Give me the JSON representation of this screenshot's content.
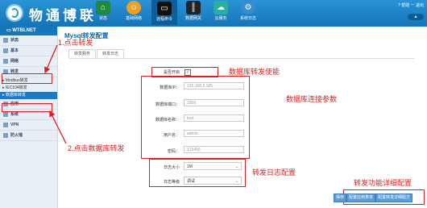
{
  "brand": {
    "name": "物通博联"
  },
  "nav": [
    {
      "label": "状态",
      "icon": "home-icon"
    },
    {
      "label": "基础网络",
      "icon": "network-icon"
    },
    {
      "label": "远程命令",
      "icon": "terminal-icon"
    },
    {
      "label": "数据网关",
      "icon": "gateway-icon"
    },
    {
      "label": "云服务",
      "icon": "cloud-icon"
    },
    {
      "label": "系统日志",
      "icon": "log-icon"
    }
  ],
  "topright": {
    "help": "? 帮助",
    "exit": "一 退出"
  },
  "sidebar": {
    "header": "WTBLNET",
    "items": [
      {
        "label": "状态"
      },
      {
        "label": "基本"
      },
      {
        "label": "网络"
      },
      {
        "label": "转发"
      }
    ],
    "subitems": [
      {
        "label": "Modbus转发"
      },
      {
        "label": "IEC104转发"
      },
      {
        "label": "数据库转发"
      }
    ],
    "items2": [
      {
        "label": "应用"
      },
      {
        "label": "系统"
      },
      {
        "label": "VPN"
      },
      {
        "label": "防火墙"
      }
    ]
  },
  "page": {
    "title": "Mysql转发配置",
    "tabs": [
      "转发服务",
      "转发日志"
    ]
  },
  "form": {
    "enable_label": "是否开启",
    "ip_label": "数据库IP：",
    "ip_value": "192.168.2.185",
    "port_label": "数据库端口：",
    "port_value": "3306",
    "name_label": "数据库名称：",
    "name_value": "test",
    "user_label": "用户名：",
    "user_value": "admin",
    "pwd_label": "密码：",
    "pwd_value": "123456",
    "logsize_label": "日志大小",
    "logsize_value": "1M",
    "loglevel_label": "日志等级",
    "loglevel_value": "调试"
  },
  "buttons": {
    "save": "保存",
    "table": "配置应用表单",
    "detail": "配置转发详细配方"
  },
  "annotations": {
    "step1": "1.点击转发",
    "step2": "2.点击数据库转发",
    "enable": "数据库转发使能",
    "conn": "数据库连接参数",
    "log": "转发日志配置",
    "detail": "转发功能详细配置"
  }
}
